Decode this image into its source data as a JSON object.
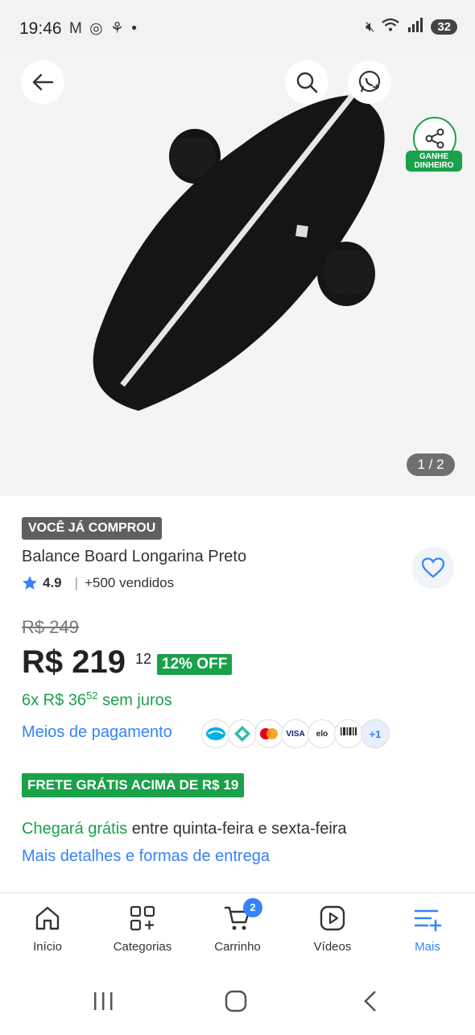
{
  "status_bar": {
    "time": "19:46",
    "left_icons": "M ◎ ⚘ •",
    "battery": "32"
  },
  "hero": {
    "image_alt": "Balance board",
    "brand_on_board": "",
    "pager": "1 / 2",
    "share_badge": "GANHE\nDINHEIRO"
  },
  "product": {
    "bought_badge": "VOCÊ JÁ COMPROU",
    "title": "Balance Board Longarina Preto",
    "rating": "4.9",
    "sold": "+500 vendidos",
    "old_price": "R$ 249",
    "price": "R$ 219",
    "cents": "12",
    "discount": "12% OFF",
    "installments_prefix": "6x R$ 36",
    "installments_cents": "52",
    "installments_suffix": "sem juros",
    "payments_link": "Meios de pagamento",
    "payment_methods": [
      "MP",
      "PIX",
      "MC",
      "VISA",
      "elo",
      "Boleto",
      "+1"
    ]
  },
  "shipping": {
    "free_badge": "FRETE GRÁTIS ACIMA DE R$ 19",
    "arrival_green": "Chegará grátis",
    "arrival_rest": " entre quinta-feira e sexta-feira",
    "details_link": "Mais detalhes e formas de entrega"
  },
  "bottom_nav": {
    "items": [
      {
        "label": "Início",
        "icon": "home-icon"
      },
      {
        "label": "Categorias",
        "icon": "categories-icon"
      },
      {
        "label": "Carrinho",
        "icon": "cart-icon",
        "badge": "2"
      },
      {
        "label": "Vídeos",
        "icon": "video-icon"
      },
      {
        "label": "Mais",
        "icon": "menu-plus-icon"
      }
    ],
    "active_color": "#3483fa"
  },
  "colors": {
    "green": "#1aa14a",
    "blue": "#3483fa"
  }
}
